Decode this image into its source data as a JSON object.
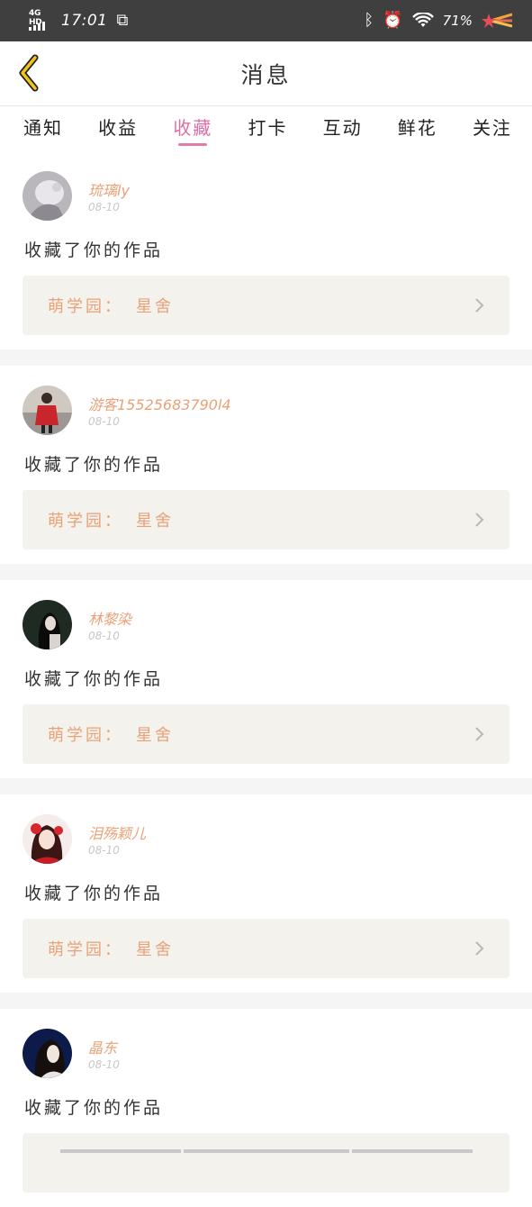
{
  "status_bar": {
    "network": "4G HD",
    "time": "17:01",
    "battery_percent": "71%"
  },
  "header": {
    "title": "消息",
    "back_icon": "chevron-left-icon",
    "accent_color": "#f0c419"
  },
  "tabs": [
    {
      "label": "通知",
      "active": false
    },
    {
      "label": "收益",
      "active": false
    },
    {
      "label": "收藏",
      "active": true
    },
    {
      "label": "打卡",
      "active": false
    },
    {
      "label": "互动",
      "active": false
    },
    {
      "label": "鲜花",
      "active": false
    },
    {
      "label": "关注",
      "active": false
    }
  ],
  "colors": {
    "active_tab": "#dc6fa5",
    "name_and_link": "#e9a278",
    "link_background": "#f3f2ec"
  },
  "messages": [
    {
      "user": "琉璃ly",
      "time": "08-10",
      "text": "收藏了你的作品",
      "work_prefix": "萌学园：",
      "work_title": "星舍"
    },
    {
      "user": "游客15525683790l4",
      "time": "08-10",
      "text": "收藏了你的作品",
      "work_prefix": "萌学园：",
      "work_title": "星舍"
    },
    {
      "user": "林黎染",
      "time": "08-10",
      "text": "收藏了你的作品",
      "work_prefix": "萌学园：",
      "work_title": "星舍"
    },
    {
      "user": "泪殇颖儿",
      "time": "08-10",
      "text": "收藏了你的作品",
      "work_prefix": "萌学园：",
      "work_title": "星舍"
    },
    {
      "user": "晶东",
      "time": "08-10",
      "text": "收藏了你的作品",
      "work_prefix": "",
      "work_title": ""
    }
  ]
}
